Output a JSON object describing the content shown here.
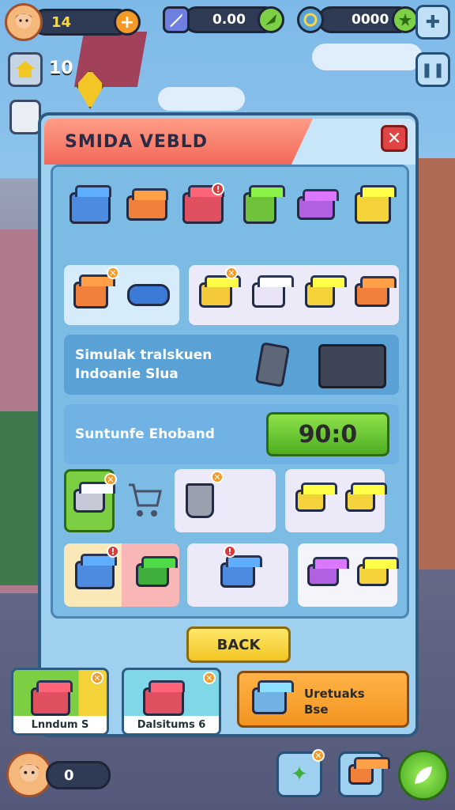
{
  "hud": {
    "level": "14",
    "cash": "0.00",
    "gems": "0000",
    "left_counter": "10"
  },
  "dialog": {
    "title": "SMIDA VEBLD",
    "close_label": "✕",
    "row1_icons": [
      "register-icon",
      "crate-icon",
      "stall-icon",
      "paint-bucket-icon",
      "mixer-icon",
      "yellow-box-icon"
    ],
    "row2_icons": [
      "produce-crate-icon",
      "scanner-icon",
      "basket-icon",
      "box-icon",
      "yellow-crate-icon",
      "shop-icon"
    ],
    "info_line1": "Simulak tralskuen",
    "info_line2": "Indoanie Slua",
    "timer_label": "Suntunfe Ehoband",
    "timer_value": "90:0",
    "back_label": "BACK"
  },
  "tray": {
    "card1_label": "Lnndum S",
    "card2_label": "Dalsitums 6",
    "card3_line1": "Uretuaks",
    "card3_line2": "Bse"
  },
  "bottom": {
    "counter": "0"
  },
  "colors": {
    "panel_bg": "#9fd0ef",
    "title_ribbon": "#f2695c",
    "timer_green": "#4fae21",
    "back_yellow": "#f2c624",
    "close_red": "#e24343"
  }
}
